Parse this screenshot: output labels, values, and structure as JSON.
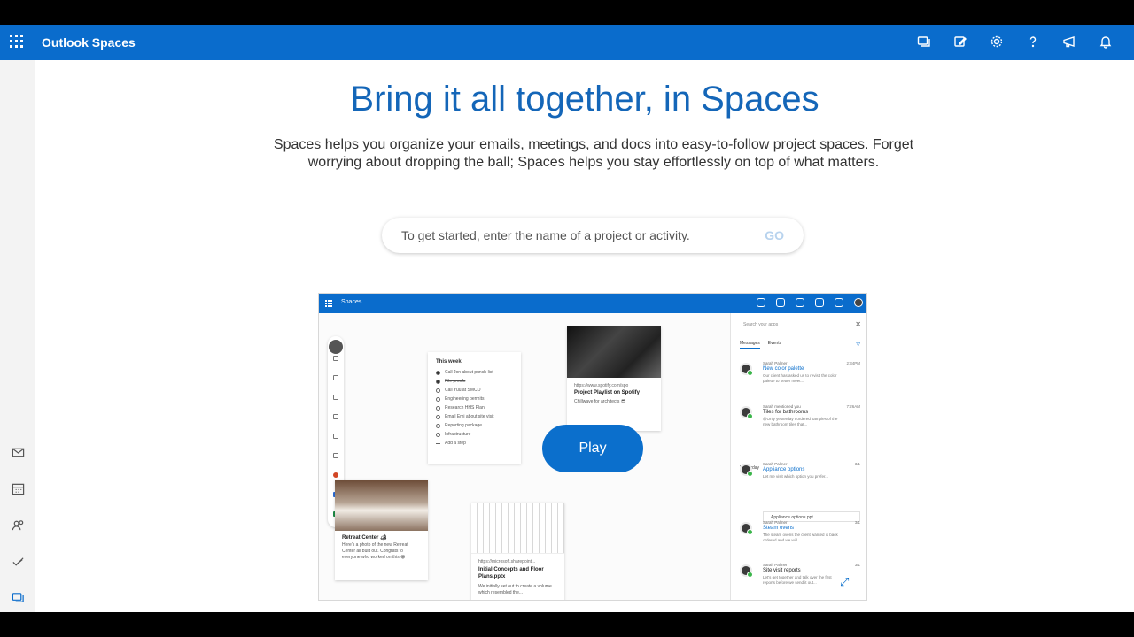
{
  "app": {
    "title": "Outlook Spaces"
  },
  "toolbar": {
    "icons": [
      "spaces-icon",
      "compose-icon",
      "settings-gear-icon",
      "help-icon",
      "feedback-megaphone-icon",
      "bell-icon"
    ]
  },
  "rail": {
    "icons": [
      "mail-icon",
      "calendar-icon",
      "people-icon",
      "todo-check-icon",
      "spaces-app-icon"
    ]
  },
  "main": {
    "hero": "Bring it all together, in Spaces",
    "description": "Spaces helps you organize your emails, meetings, and docs into easy-to-follow project spaces. Forget worrying about dropping the ball; Spaces helps you stay effortlessly on top of what matters.",
    "search_placeholder": "To get started, enter the name of a project or activity.",
    "go_label": "GO"
  },
  "preview": {
    "title": "Spaces",
    "play_label": "Play",
    "todo": {
      "header": "This week",
      "items": [
        {
          "text": "Call Jon about punch-list",
          "done": true
        },
        {
          "text": "File proofs",
          "done": true
        },
        {
          "text": "Call Yuu at SMCO",
          "done": false
        },
        {
          "text": "Engineering permits",
          "done": false
        },
        {
          "text": "Research HHS Plan",
          "done": false
        },
        {
          "text": "Email Emi about site visit",
          "done": false
        },
        {
          "text": "Reporting package",
          "done": false
        },
        {
          "text": "Infrastructure",
          "done": false
        },
        {
          "text": "Add a step",
          "done": false
        }
      ]
    },
    "playlist": {
      "url": "https://www.spotify.com/spo",
      "title": "Project Playlist on Spotify",
      "sub": "Chillwave for architects 😎"
    },
    "retreat": {
      "title": "Retreat Center 🏕",
      "sub": "Here's a photo of the new Retreat Center all built out. Congrats to everyone who worked on this 😀"
    },
    "floor": {
      "url": "https://microsoft.sharepoint...",
      "title": "Initial Concepts and Floor Plans.pptx",
      "sub": "We initially set out to create a volume which resembled the..."
    },
    "pane": {
      "search": "Search your apps",
      "tabs": [
        "Messages",
        "Events"
      ],
      "yesterday": "Yesterday",
      "messages": [
        {
          "from": "Sarah Palmer",
          "subject": "New color palette",
          "time": "2:34PM",
          "preview": "Our client has asked us to revisit the color palette to better meet..."
        },
        {
          "from": "Sarah mentioned you",
          "subject": "Tiles for bathrooms",
          "time": "7:26AM",
          "preview": "@Only yesterday I ordered samples of the new bathroom tiles that..."
        },
        {
          "from": "Sarah Palmer",
          "subject": "Appliance options",
          "time": "3/1",
          "preview": "Let me visit which option you prefer..."
        },
        {
          "from": "Sarah Palmer",
          "subject": "Steam ovens",
          "time": "3/1",
          "preview": "The steam ovens the client wanted is back ordered and we will..."
        },
        {
          "from": "Sarah Palmer",
          "subject": "Site visit reports",
          "time": "3/1",
          "preview": "Let's get together and talk over the first reports before we send it out..."
        }
      ],
      "attachment": "Appliance options.ppt"
    }
  }
}
